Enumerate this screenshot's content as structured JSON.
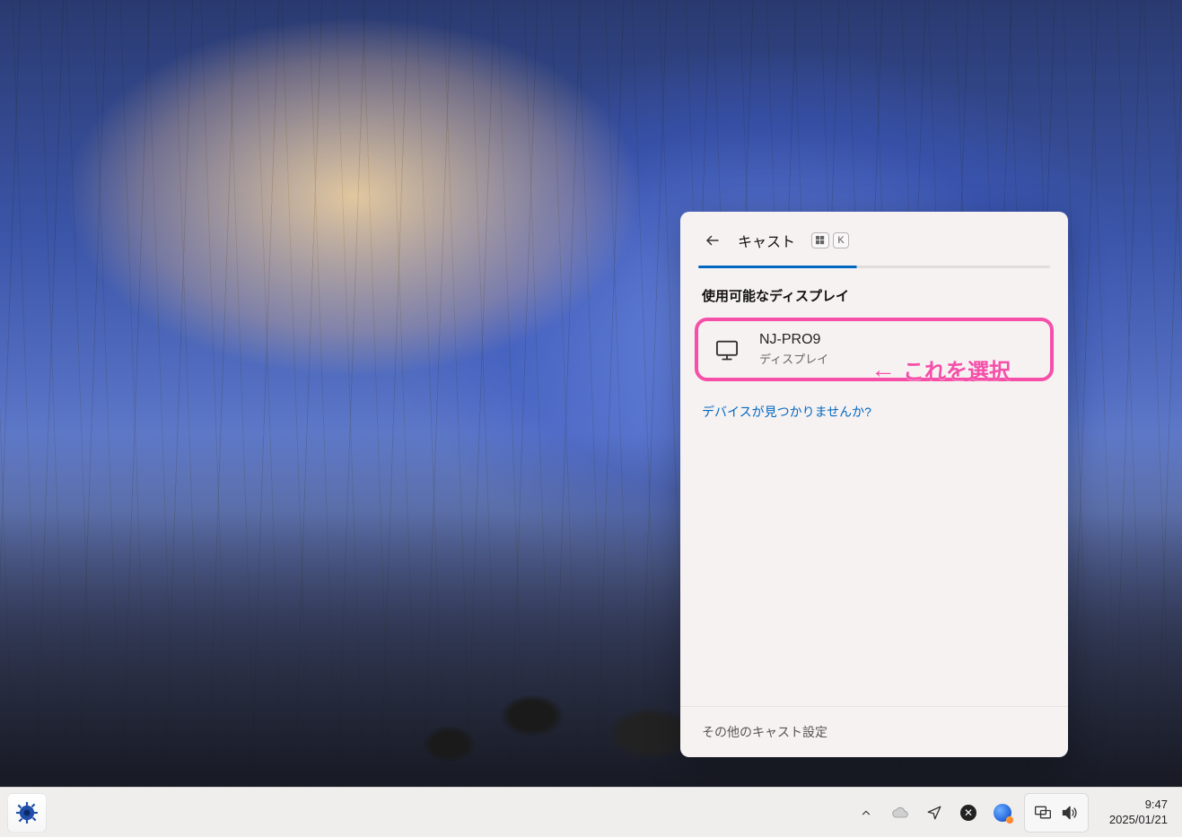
{
  "cast": {
    "title": "キャスト",
    "shortcut_keys": {
      "win": "⊞",
      "k": "K"
    },
    "section_label": "使用可能なディスプレイ",
    "device": {
      "name": "NJ-PRO9",
      "type": "ディスプレイ"
    },
    "not_found_link": "デバイスが見つかりませんか?",
    "footer_link": "その他のキャスト設定"
  },
  "annotation": {
    "arrow": "←",
    "text": "これを選択"
  },
  "taskbar": {
    "time": "9:47",
    "date": "2025/01/21"
  }
}
